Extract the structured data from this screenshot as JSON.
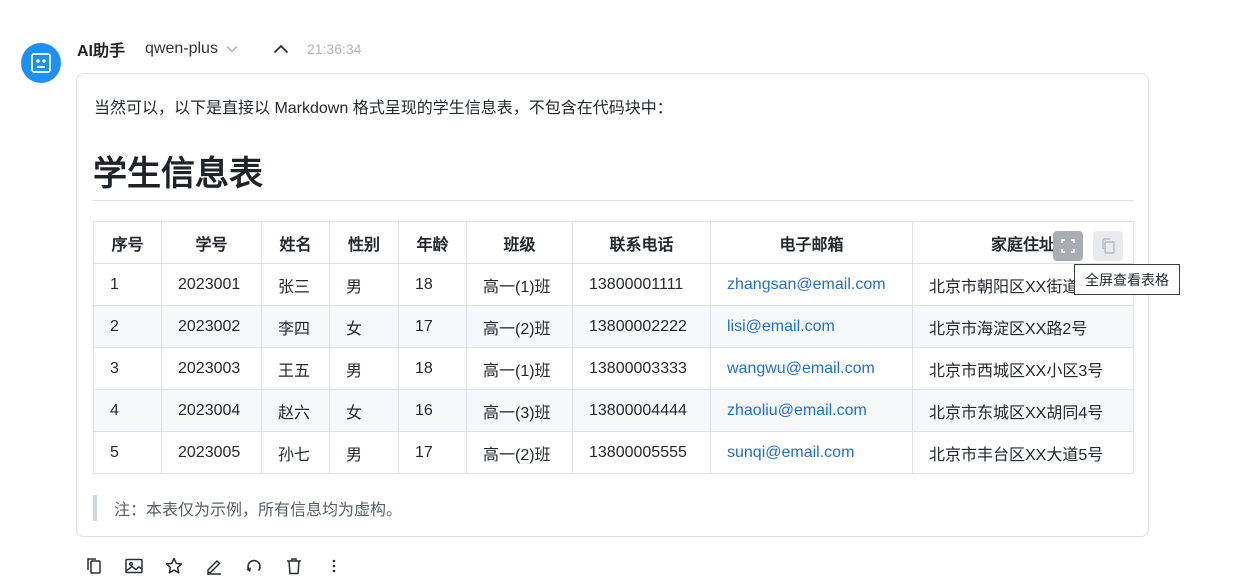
{
  "message": {
    "sender": "AI助手",
    "model": "qwen-plus",
    "time": "21:36:34",
    "intro": "当然可以，以下是直接以 Markdown 格式呈现的学生信息表，不包含在代码块中：",
    "title": "学生信息表",
    "note": "注：本表仅为示例，所有信息均为虚构。"
  },
  "table": {
    "headers": [
      "序号",
      "学号",
      "姓名",
      "性别",
      "年龄",
      "班级",
      "联系电话",
      "电子邮箱",
      "家庭住址"
    ],
    "rows": [
      [
        "1",
        "2023001",
        "张三",
        "男",
        "18",
        "高一(1)班",
        "13800001111",
        "zhangsan@email.com",
        "北京市朝阳区XX街道1号"
      ],
      [
        "2",
        "2023002",
        "李四",
        "女",
        "17",
        "高一(2)班",
        "13800002222",
        "lisi@email.com",
        "北京市海淀区XX路2号"
      ],
      [
        "3",
        "2023003",
        "王五",
        "男",
        "18",
        "高一(1)班",
        "13800003333",
        "wangwu@email.com",
        "北京市西城区XX小区3号"
      ],
      [
        "4",
        "2023004",
        "赵六",
        "女",
        "16",
        "高一(3)班",
        "13800004444",
        "zhaoliu@email.com",
        "北京市东城区XX胡同4号"
      ],
      [
        "5",
        "2023005",
        "孙七",
        "男",
        "17",
        "高一(2)班",
        "13800005555",
        "sunqi@email.com",
        "北京市丰台区XX大道5号"
      ]
    ]
  },
  "table_tools": {
    "fullscreen_icon": "fullscreen-icon",
    "copy_icon": "copy-icon",
    "tooltip": "全屏查看表格"
  },
  "actions": [
    "copy-icon",
    "image-icon",
    "star-icon",
    "edit-icon",
    "regenerate-icon",
    "delete-icon",
    "more-icon"
  ],
  "colors": {
    "accent": "#1e90f5",
    "link": "#1f6fd1",
    "stripe": "#f6f8fa",
    "border": "#dfe2e5"
  }
}
